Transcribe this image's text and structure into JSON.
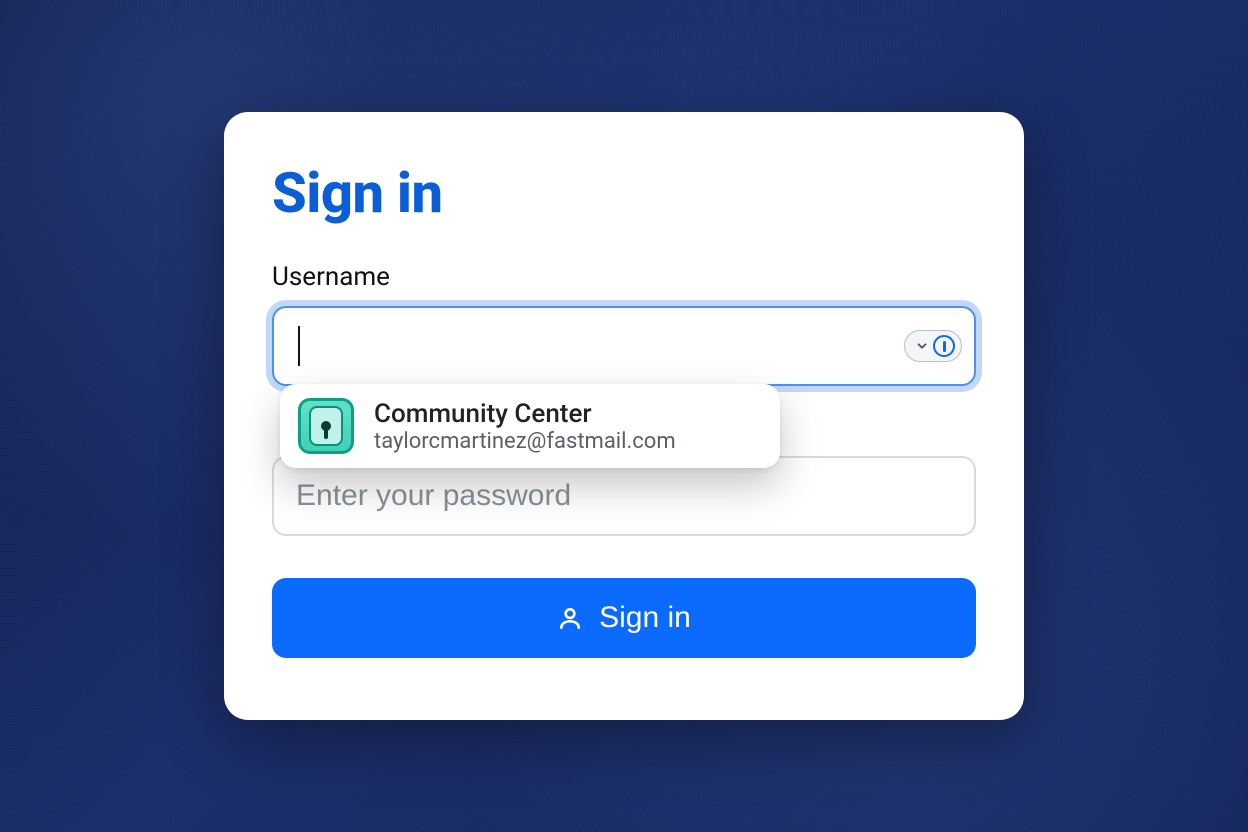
{
  "page": {
    "title": "Sign in"
  },
  "username": {
    "label": "Username",
    "value": "",
    "placeholder": ""
  },
  "password": {
    "placeholder": "Enter your password",
    "value": ""
  },
  "autofill_suggestion": {
    "site_name": "Community Center",
    "account": "taylorcmartinez@fastmail.com"
  },
  "button": {
    "label": "Sign in"
  },
  "colors": {
    "accent": "#0b6bff",
    "heading": "#0b5ed7"
  }
}
